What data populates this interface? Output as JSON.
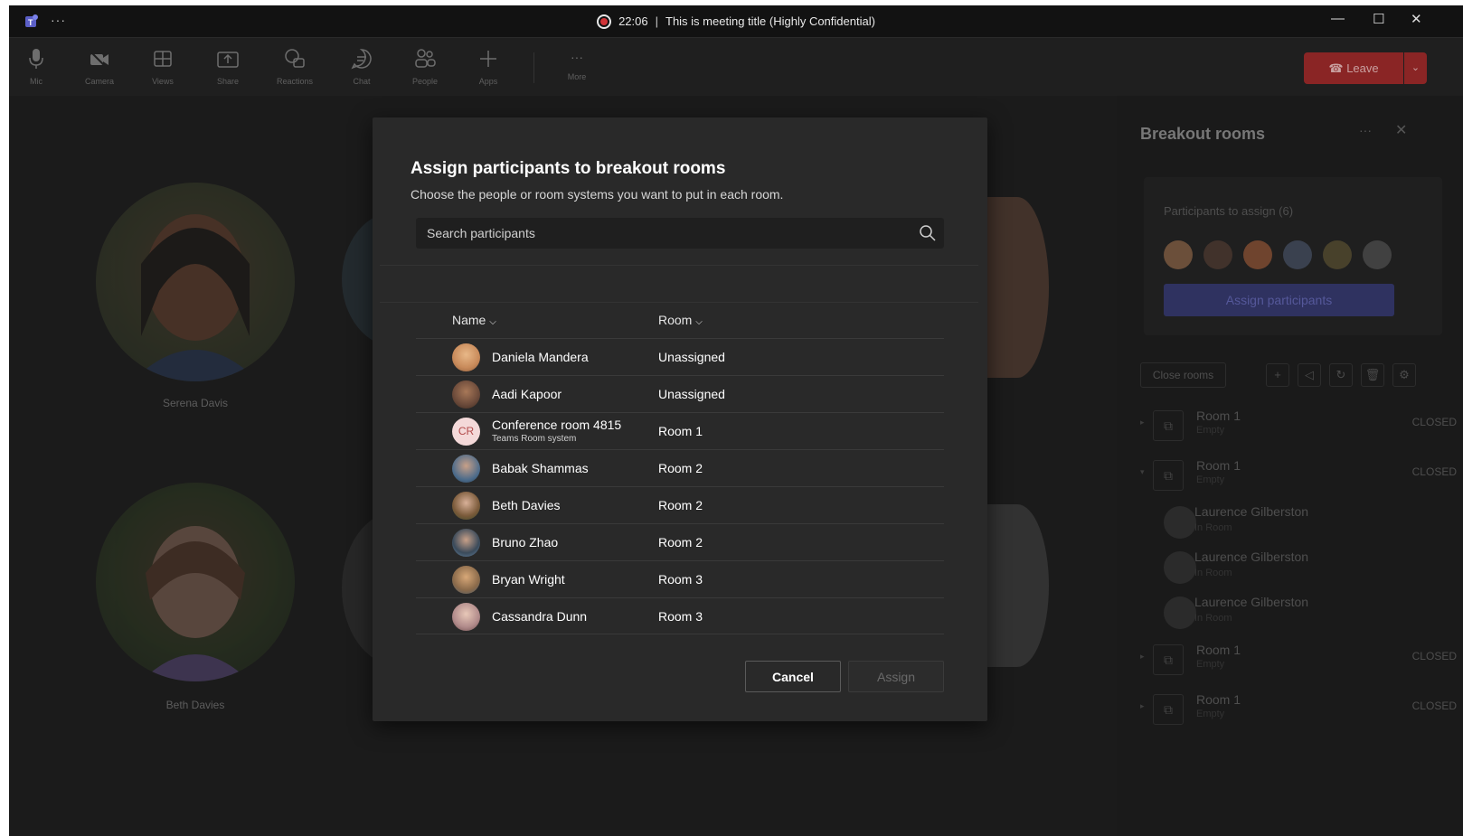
{
  "titlebar": {
    "timer": "22:06",
    "separator": "|",
    "meeting_title": "This is meeting title (Highly Confidential)",
    "more": "···"
  },
  "toolbar": {
    "items": [
      {
        "label": "Mic",
        "icon": "mic-icon"
      },
      {
        "label": "Camera",
        "icon": "camera-off-icon"
      },
      {
        "label": "Views",
        "icon": "views-icon"
      },
      {
        "label": "Share",
        "icon": "share-icon"
      },
      {
        "label": "Reactions",
        "icon": "reactions-icon"
      },
      {
        "label": "Chat",
        "icon": "chat-icon"
      },
      {
        "label": "People",
        "icon": "people-icon"
      },
      {
        "label": "Apps",
        "icon": "add-icon"
      },
      {
        "label": "More",
        "icon": "more-icon"
      }
    ],
    "leave_label": "Leave"
  },
  "stage": {
    "participants": [
      {
        "name": "Serena Davis"
      },
      {
        "name": "Beth Davies"
      }
    ]
  },
  "side_panel": {
    "title": "Breakout rooms",
    "more": "···",
    "participants_to_assign": "Participants to assign (6)",
    "assign_participants_label": "Assign participants",
    "close_rooms_label": "Close rooms",
    "rooms": [
      {
        "name": "Room 1",
        "sub": "Empty",
        "status": "CLOSED"
      },
      {
        "name": "Room 1",
        "sub": "Empty",
        "status": "CLOSED"
      }
    ],
    "members": [
      {
        "name": "Laurence Gilberston",
        "sub": "In Room"
      },
      {
        "name": "Laurence Gilberston",
        "sub": "In Room"
      },
      {
        "name": "Laurence Gilberston",
        "sub": "In Room"
      }
    ],
    "rooms_after": [
      {
        "name": "Room 1",
        "sub": "Empty",
        "status": "CLOSED"
      },
      {
        "name": "Room 1",
        "sub": "Empty",
        "status": "CLOSED"
      }
    ]
  },
  "dialog": {
    "title": "Assign participants to breakout rooms",
    "subtitle": "Choose the people or room systems you want to put in each room.",
    "search_placeholder": "Search participants",
    "columns": {
      "name": "Name",
      "room": "Room"
    },
    "rows": [
      {
        "name": "Daniela Mandera",
        "room": "Unassigned",
        "avatar_color": "#c88a5a"
      },
      {
        "name": "Aadi Kapoor",
        "room": "Unassigned",
        "avatar_color": "#6b4a3a"
      },
      {
        "name": "Conference room 4815",
        "subtitle": "Teams Room system",
        "room": "Room 1",
        "initials": "CR"
      },
      {
        "name": "Babak Shammas",
        "room": "Room 2",
        "avatar_color": "#4a6a8a"
      },
      {
        "name": "Beth Davies",
        "room": "Room 2",
        "avatar_color": "#7a5a3a"
      },
      {
        "name": "Bruno Zhao",
        "room": "Room 2",
        "avatar_color": "#3a4a5a"
      },
      {
        "name": "Bryan Wright",
        "room": "Room 3",
        "avatar_color": "#8a6a4a"
      },
      {
        "name": "Cassandra Dunn",
        "room": "Room 3",
        "avatar_color": "#b08a8a"
      }
    ],
    "cancel_label": "Cancel",
    "assign_label": "Assign"
  }
}
